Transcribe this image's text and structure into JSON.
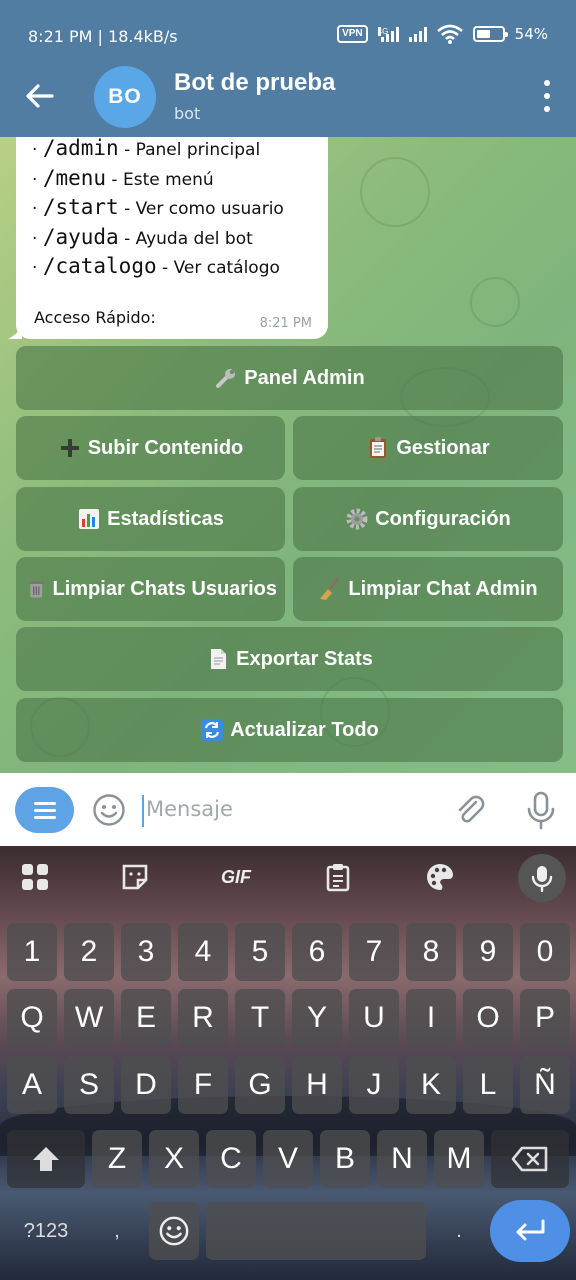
{
  "status_bar": {
    "time_speed": "8:21 PM | 18.4kB/s",
    "vpn": "VPN",
    "network": "4G",
    "battery": "54%",
    "battery_level": 0.54
  },
  "header": {
    "avatar_initials": "BO",
    "title": "Bot de prueba",
    "subtitle": "bot"
  },
  "message": {
    "commands": [
      {
        "cmd": "/admin",
        "desc": "Panel principal"
      },
      {
        "cmd": "/menu",
        "desc": "Este menú"
      },
      {
        "cmd": "/start",
        "desc": "Ver como usuario"
      },
      {
        "cmd": "/ayuda",
        "desc": "Ayuda del bot"
      },
      {
        "cmd": "/catalogo",
        "desc": "Ver catálogo"
      }
    ],
    "quick_access": "Acceso Rápido:",
    "time": "8:21 PM"
  },
  "inline_keyboard": {
    "panel_admin": "Panel Admin",
    "subir_contenido": "Subir Contenido",
    "gestionar": "Gestionar",
    "estadisticas": "Estadísticas",
    "configuracion": "Configuración",
    "limpiar_usuarios": "Limpiar Chats Usuarios",
    "limpiar_admin": "Limpiar Chat Admin",
    "exportar": "Exportar Stats",
    "actualizar": "Actualizar Todo"
  },
  "input": {
    "placeholder": "Mensaje"
  },
  "keyboard": {
    "gif_label": "GIF",
    "row_numbers": [
      "1",
      "2",
      "3",
      "4",
      "5",
      "6",
      "7",
      "8",
      "9",
      "0"
    ],
    "row_top": [
      "Q",
      "W",
      "E",
      "R",
      "T",
      "Y",
      "U",
      "I",
      "O",
      "P"
    ],
    "row_mid": [
      "A",
      "S",
      "D",
      "F",
      "G",
      "H",
      "J",
      "K",
      "L",
      "Ñ"
    ],
    "row_bottom": [
      "Z",
      "X",
      "C",
      "V",
      "B",
      "N",
      "M"
    ],
    "symbols_label": "?123",
    "comma": ",",
    "period": "."
  }
}
